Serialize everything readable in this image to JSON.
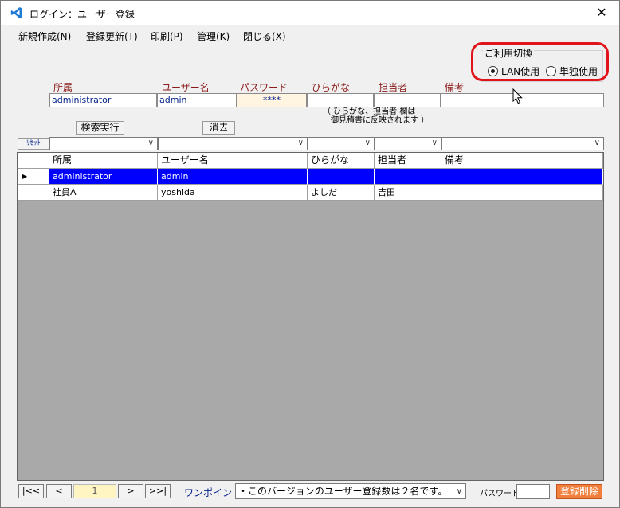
{
  "window": {
    "title": "ログイン：ユーザー登録",
    "close_glyph": "✕"
  },
  "menu": [
    {
      "label": "新規作成(N)"
    },
    {
      "label": "登録更新(T)"
    },
    {
      "label": "印刷(P)"
    },
    {
      "label": "管理(K)"
    },
    {
      "label": "閉じる(X)"
    }
  ],
  "mode": {
    "title": "ご利用切換",
    "options": [
      {
        "label": "LAN使用",
        "selected": true
      },
      {
        "label": "単独使用",
        "selected": false
      }
    ],
    "highlight_color": "#e0141b"
  },
  "form": {
    "labels": {
      "dept": "所属",
      "user": "ユーザー名",
      "password": "パスワード",
      "kana": "ひらがな",
      "staff": "担当者",
      "note": "備考"
    },
    "values": {
      "dept": "administrator",
      "user": "admin",
      "password": "****",
      "kana": "",
      "staff": "",
      "note": ""
    },
    "hint_line1": "（ ひらがな、担当者 欄は",
    "hint_line2": "　御見積書に反映されます ）",
    "search_button": "検索実行",
    "clear_button": "消去"
  },
  "filter": {
    "reset_label": "ﾘｾｯﾄ"
  },
  "grid": {
    "headers": [
      "所属",
      "ユーザー名",
      "ひらがな",
      "担当者",
      "備考"
    ],
    "rows": [
      {
        "selected": true,
        "cells": [
          "administrator",
          "admin",
          "",
          "",
          ""
        ]
      },
      {
        "selected": false,
        "cells": [
          "社員A",
          "yoshida",
          "よしだ",
          "吉田",
          ""
        ]
      }
    ],
    "selection_color": "#0000ff"
  },
  "footer": {
    "nav": {
      "first": "|<<",
      "prev": "<",
      "page": "1",
      "next": ">",
      "last": ">>|"
    },
    "onepoint_label": "ワンポイント:",
    "onepoint_value": "・このバージョンのユーザー登録数は２名です。",
    "password_label": "パスワード",
    "delete_button": "登録削除",
    "delete_color": "#f27f3c"
  },
  "icons": {
    "app": "vscode-like-icon",
    "close": "close-icon",
    "dropdown": "chevron-down-icon",
    "row_pointer": "triangle-right-icon",
    "mouse": "mouse-cursor-icon"
  }
}
